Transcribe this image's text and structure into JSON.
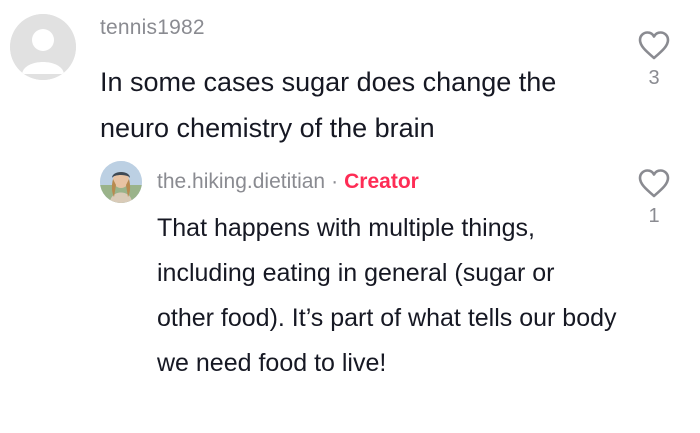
{
  "comment": {
    "username": "tennis1982",
    "text": "In some cases sugar does change the neuro chemistry of the brain",
    "likes": "3",
    "avatar_icon": "default-avatar-icon",
    "like_icon": "heart-outline-icon"
  },
  "reply": {
    "username": "the.hiking.dietitian",
    "separator": "·",
    "badge": "Creator",
    "text": "That happens with multiple things, including eating in general (sugar or other food). It’s part of what tells our body we need food to live!",
    "likes": "1",
    "avatar_icon": "profile-photo-icon",
    "like_icon": "heart-outline-icon"
  },
  "colors": {
    "text_primary": "#161823",
    "text_secondary": "#8a8b91",
    "creator_badge": "#fe2c55"
  }
}
